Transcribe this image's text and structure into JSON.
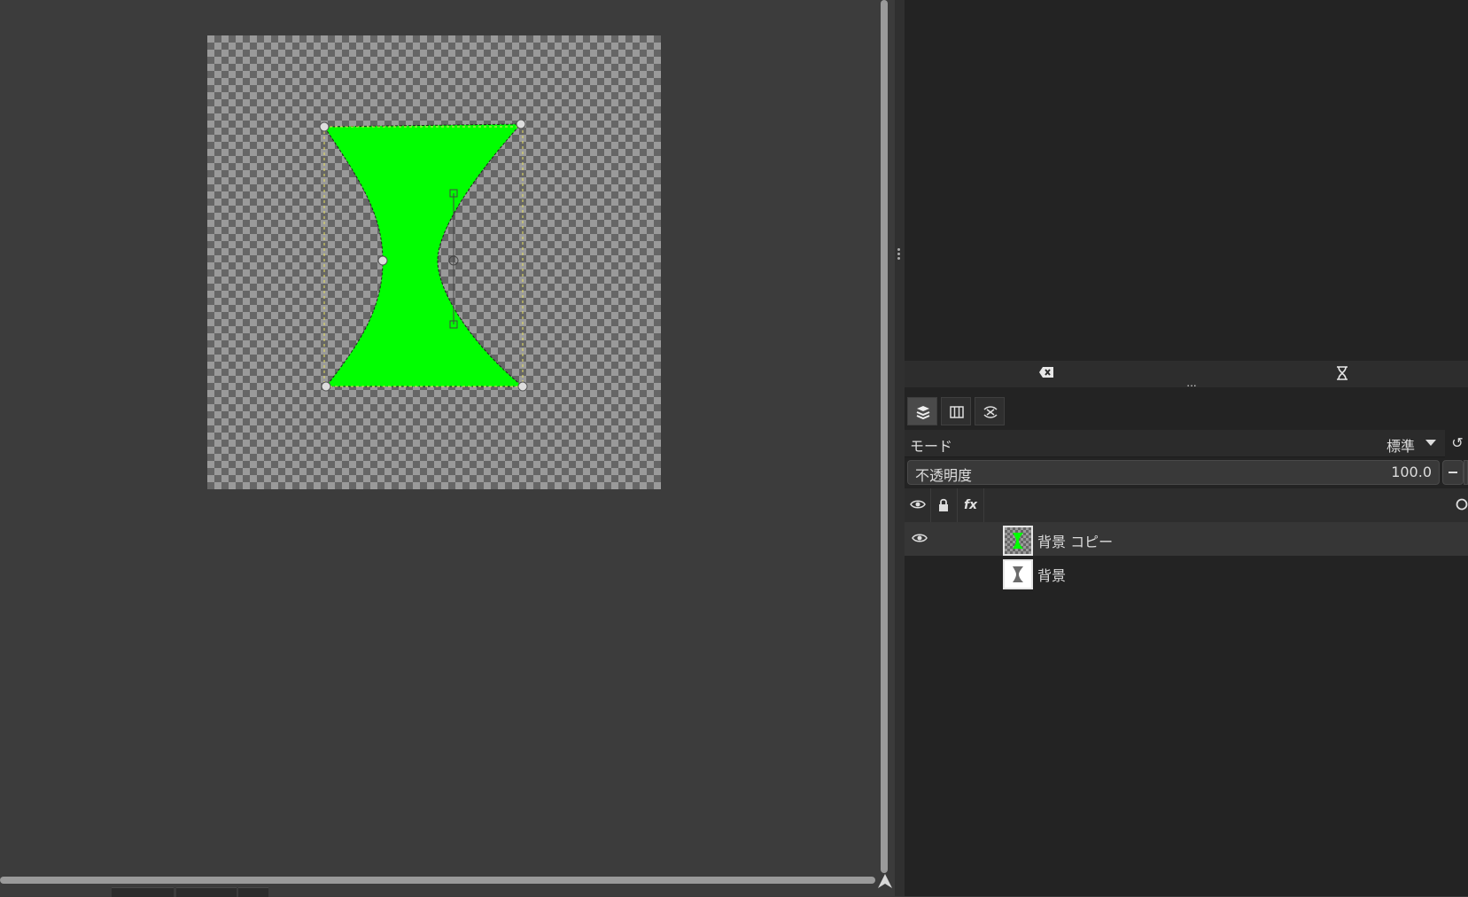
{
  "canvas": {
    "shape_fill": "#00ff00",
    "background": "checkerboard"
  },
  "dock_toolbar": {
    "left_icon": "clear-icon",
    "right_icon": "hourglass-icon",
    "more": "..."
  },
  "layers_panel": {
    "tabs": [
      "layers-icon",
      "channels-icon",
      "paths-icon"
    ],
    "mode": {
      "label": "モード",
      "value": "標準"
    },
    "opacity": {
      "label": "不透明度",
      "value": "100.0"
    },
    "header": {
      "fx_label": "fx"
    },
    "layers": [
      {
        "name": "背景 コピー",
        "visible": true,
        "selected": true
      },
      {
        "name": "背景",
        "visible": false,
        "selected": false
      }
    ]
  }
}
